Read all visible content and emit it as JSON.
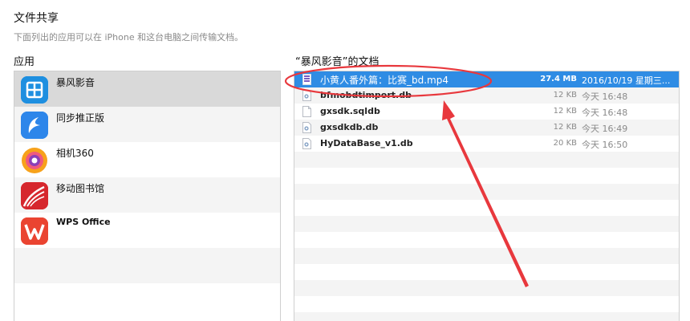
{
  "header": {
    "title": "文件共享",
    "description": "下面列出的应用可以在 iPhone 和这台电脑之间传输文档。"
  },
  "apps": {
    "header": "应用",
    "items": [
      {
        "label": "暴风影音",
        "icon": "baofeng-app-icon",
        "selected": true
      },
      {
        "label": "同步推正版",
        "icon": "tongbutui-app-icon",
        "selected": false
      },
      {
        "label": "相机360",
        "icon": "camera360-app-icon",
        "selected": false
      },
      {
        "label": "移动图书馆",
        "icon": "mobile-library-app-icon",
        "selected": false
      },
      {
        "label": "WPS Office",
        "icon": "wps-office-app-icon",
        "selected": false
      }
    ]
  },
  "documents": {
    "header": "“暴风影音”的文档",
    "files": [
      {
        "name": "小黄人番外篇：比赛_bd.mp4",
        "size": "27.4 MB",
        "date": "2016/10/19 星期三...",
        "icon": "video-file-icon",
        "selected": true
      },
      {
        "name": "bfmobdtimport.db",
        "size": "12 KB",
        "date": "今天 16:48",
        "icon": "database-file-icon",
        "selected": false
      },
      {
        "name": "gxsdk.sqldb",
        "size": "12 KB",
        "date": "今天 16:48",
        "icon": "blank-file-icon",
        "selected": false
      },
      {
        "name": "gxsdkdb.db",
        "size": "12 KB",
        "date": "今天 16:49",
        "icon": "database-file-icon",
        "selected": false
      },
      {
        "name": "HyDataBase_v1.db",
        "size": "20 KB",
        "date": "今天 16:50",
        "icon": "database-file-icon",
        "selected": false
      }
    ]
  },
  "colors": {
    "selection_blue": "#2f8ce4",
    "annotation_red": "#e8383d",
    "selected_app_bg": "#d9d9d9"
  }
}
